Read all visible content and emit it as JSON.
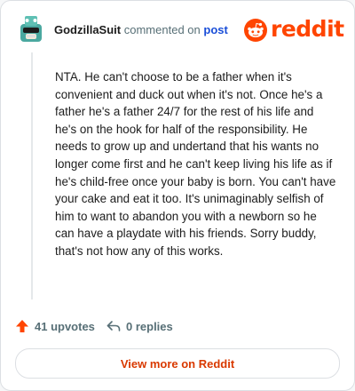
{
  "header": {
    "username": "GodzillaSuit",
    "action_text": "commented on",
    "post_link": "post",
    "logo_text": "reddit"
  },
  "comment": {
    "body": "NTA. He can't choose to be a father when it's convenient and duck out when it's not. Once he's a father he's a father 24/7 for the rest of his life and he's on the hook for half of the responsibility. He needs to grow up and undertand that his wants no longer come first and he can't keep living his life as if he's child-free once your baby is born. You can't have your cake and eat it too. It's unimaginably selfish of him to want to abandon you with a newborn so he can have a playdate with his friends. Sorry buddy, that's not how any of this works."
  },
  "footer": {
    "upvotes": "41 upvotes",
    "replies": "0 replies",
    "view_more": "View more on Reddit"
  },
  "icons": {
    "upvote": "upvote-arrow-icon",
    "reply": "reply-arrow-icon",
    "logo": "reddit-snoo-icon",
    "avatar": "avatar-icon"
  },
  "colors": {
    "brand": "#ff4500",
    "link": "#1a4ed8",
    "view_more": "#d93900",
    "muted": "#576f76"
  }
}
